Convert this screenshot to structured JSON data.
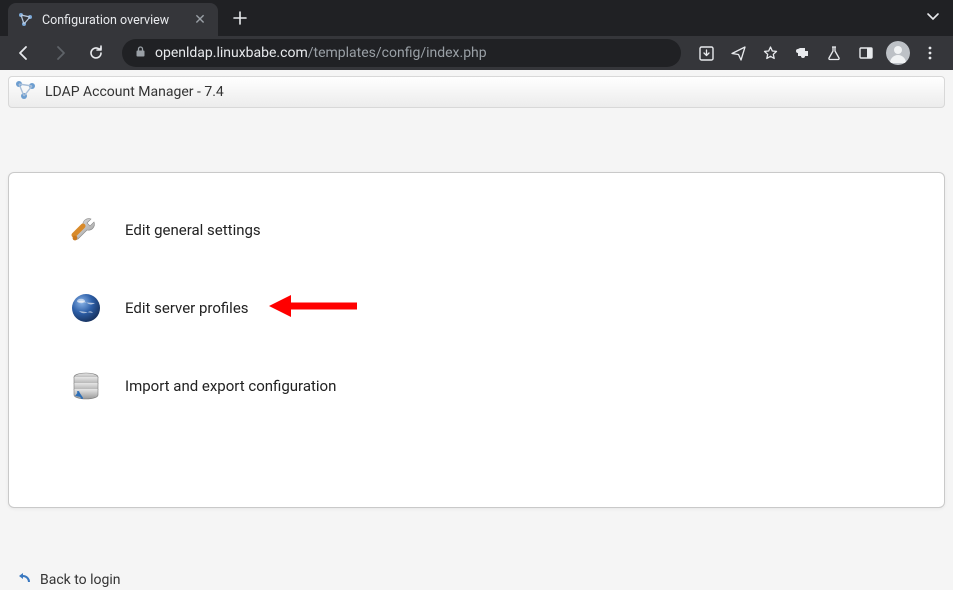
{
  "browser": {
    "tab_title": "Configuration overview",
    "url_host": "openldap.linuxbabe.com",
    "url_path": "/templates/config/index.php"
  },
  "header": {
    "app_title": "LDAP Account Manager - 7.4"
  },
  "menu": {
    "general": "Edit general settings",
    "profiles": "Edit server profiles",
    "import_export": "Import and export configuration"
  },
  "footer": {
    "back_to_login": "Back to login"
  }
}
